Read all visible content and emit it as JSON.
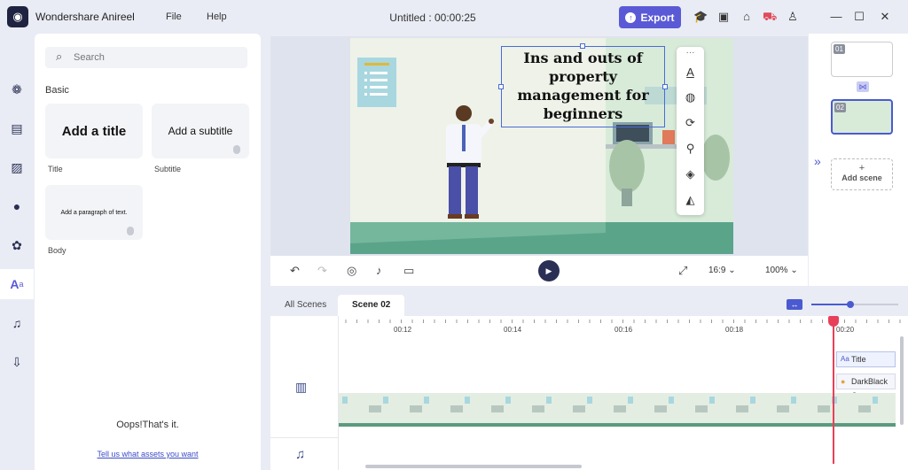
{
  "app": {
    "name": "Wondershare Anireel",
    "menu": [
      "File",
      "Help"
    ],
    "document_title": "Untitled : 00:00:25",
    "export_label": "Export"
  },
  "sidebar": {
    "items": [
      {
        "name": "character-icon"
      },
      {
        "name": "scene-icon"
      },
      {
        "name": "background-icon"
      },
      {
        "name": "person-icon"
      },
      {
        "name": "props-icon"
      },
      {
        "name": "text-icon",
        "active": true
      },
      {
        "name": "music-icon"
      },
      {
        "name": "import-icon"
      }
    ]
  },
  "assets_panel": {
    "search_placeholder": "Search",
    "section_label": "Basic",
    "cards": [
      {
        "preview": "Add a title",
        "caption": "Title"
      },
      {
        "preview": "Add a subtitle",
        "caption": "Subtitle"
      },
      {
        "preview": "Add a paragraph of text.",
        "caption": "Body"
      }
    ],
    "empty_message": "Oops!That's it.",
    "request_link": "Tell us what assets you want"
  },
  "canvas": {
    "text_box": "Ins and outs of property management for beginners"
  },
  "playback": {
    "aspect_ratio": "16:9",
    "zoom": "100%"
  },
  "scenes": {
    "thumbs": [
      {
        "num": "01"
      },
      {
        "num": "02",
        "selected": true
      }
    ],
    "add_label": "Add scene"
  },
  "timeline": {
    "tabs": [
      "All Scenes",
      "Scene 02"
    ],
    "ticks": [
      "00:12",
      "00:14",
      "00:16",
      "00:18",
      "00:20"
    ],
    "clips": {
      "title": "Title",
      "character": "DarkBlack O"
    }
  },
  "colors": {
    "accent": "#5a5ad6",
    "playhead": "#e8405a",
    "floor": "#5a9a7f"
  }
}
